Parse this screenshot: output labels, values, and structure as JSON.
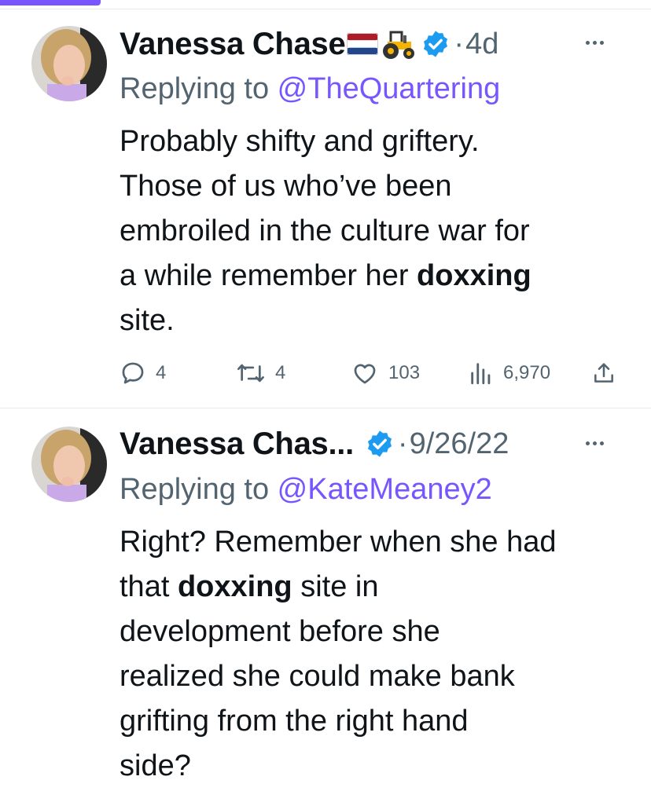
{
  "colors": {
    "accent": "#7856ff",
    "verified": "#1d9bf0",
    "muted": "#536471",
    "text": "#0f1419"
  },
  "tweets": [
    {
      "author": "Vanessa Chase",
      "emojis": [
        "netherlands-flag-icon",
        "tractor-icon"
      ],
      "verified": true,
      "dot": "·",
      "time": "4d",
      "reply_prefix": "Replying to ",
      "reply_handle": "@TheQuartering",
      "body": {
        "line1": "Probably shifty and griftery.",
        "line2": "Those of us who’ve been",
        "line3": "embroiled in the culture war for",
        "line4_pre": "a while remember her ",
        "line4_bold": "doxxing",
        "line5": "site."
      },
      "actions": {
        "replies": "4",
        "retweets": "4",
        "likes": "103",
        "views": "6,970"
      }
    },
    {
      "author": "Vanessa Chas...",
      "verified": true,
      "dot": "·",
      "time": "9/26/22",
      "reply_prefix": "Replying to ",
      "reply_handle": "@KateMeaney2",
      "body": {
        "line1": "Right? Remember when she had",
        "line2_pre": "that ",
        "line2_bold": "doxxing",
        "line2_post": " site in",
        "line3": "development before she",
        "line4": "realized she could make bank",
        "line5": "grifting from the right hand",
        "line6": "side?"
      }
    }
  ]
}
